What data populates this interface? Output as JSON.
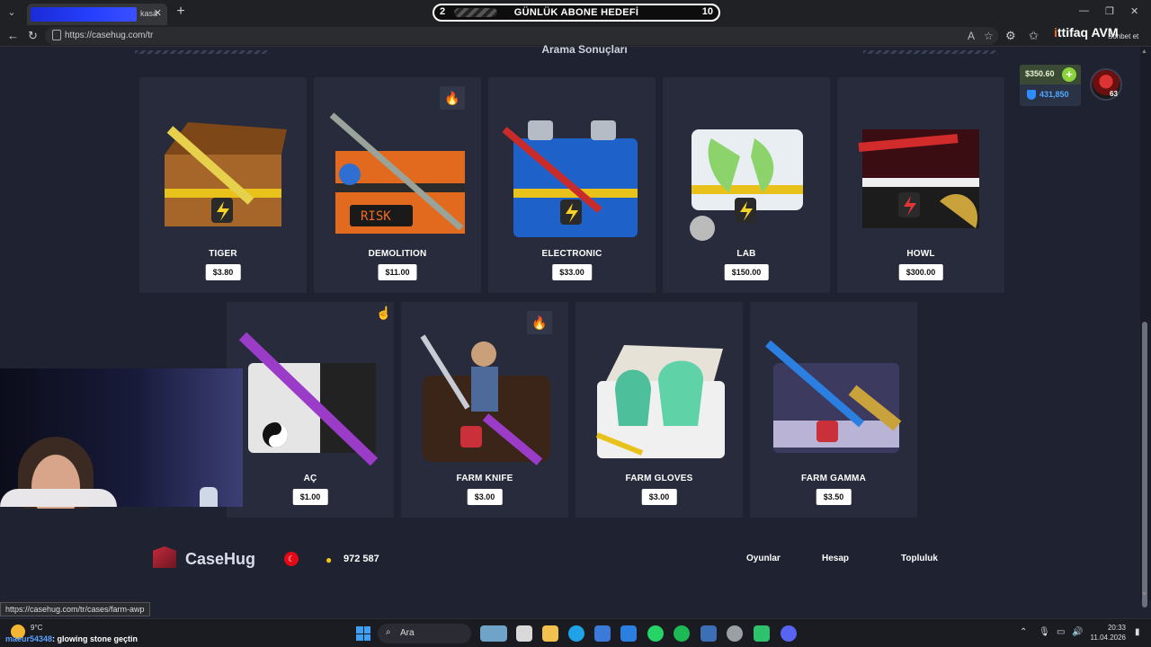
{
  "browser": {
    "tab_title": "kasa",
    "goal": {
      "left": "2",
      "title": "GÜNLÜK ABONE HEDEFİ",
      "right": "10"
    },
    "url": "https://casehug.com/tr",
    "stream_logo": {
      "prefix": "i",
      "rest": "ttifaq",
      "suffix": "AVM"
    },
    "sohbet": "Sohbet et"
  },
  "page": {
    "section_title": "Arama Sonuçları",
    "balance": {
      "amount": "$350.60",
      "points": "431,850"
    },
    "level": "63",
    "cases": [
      {
        "name": "TIGER",
        "price": "$3.80",
        "hot": false,
        "art": "tiger-case-art"
      },
      {
        "name": "DEMOLITION",
        "price": "$11.00",
        "hot": true,
        "art": "demolition-case-art"
      },
      {
        "name": "ELECTRONIC",
        "price": "$33.00",
        "hot": false,
        "art": "electronic-case-art"
      },
      {
        "name": "LAB",
        "price": "$150.00",
        "hot": false,
        "art": "lab-case-art"
      },
      {
        "name": "HOWL",
        "price": "$300.00",
        "hot": false,
        "art": "howl-case-art"
      },
      {
        "name": "AÇ",
        "price": "$1.00",
        "hot": false,
        "art": "ac-case-art"
      },
      {
        "name": "FARM KNIFE",
        "price": "$3.00",
        "hot": true,
        "art": "farm-knife-case-art"
      },
      {
        "name": "FARM GLOVES",
        "price": "$3.00",
        "hot": false,
        "art": "farm-gloves-case-art"
      },
      {
        "name": "FARM GAMMA",
        "price": "$3.50",
        "hot": false,
        "art": "farm-gamma-case-art"
      }
    ]
  },
  "footer": {
    "logo": "CaseHug",
    "online_count": "972 587",
    "links": [
      "Oyunlar",
      "Hesap",
      "Topluluk"
    ]
  },
  "status_url": "https://casehug.com/tr/cases/farm-awp",
  "taskbar": {
    "weather": "9°C",
    "ticker_user": "maeur54348",
    "ticker_text": ": glowing stone geçtin",
    "search_placeholder": "Ara",
    "time": "20:33",
    "date": "11.04.2026"
  },
  "colors": {
    "accent": "#8bd33b",
    "points": "#4fa8ff",
    "card_bg": "#272b3b",
    "page_bg": "#1f2230"
  }
}
